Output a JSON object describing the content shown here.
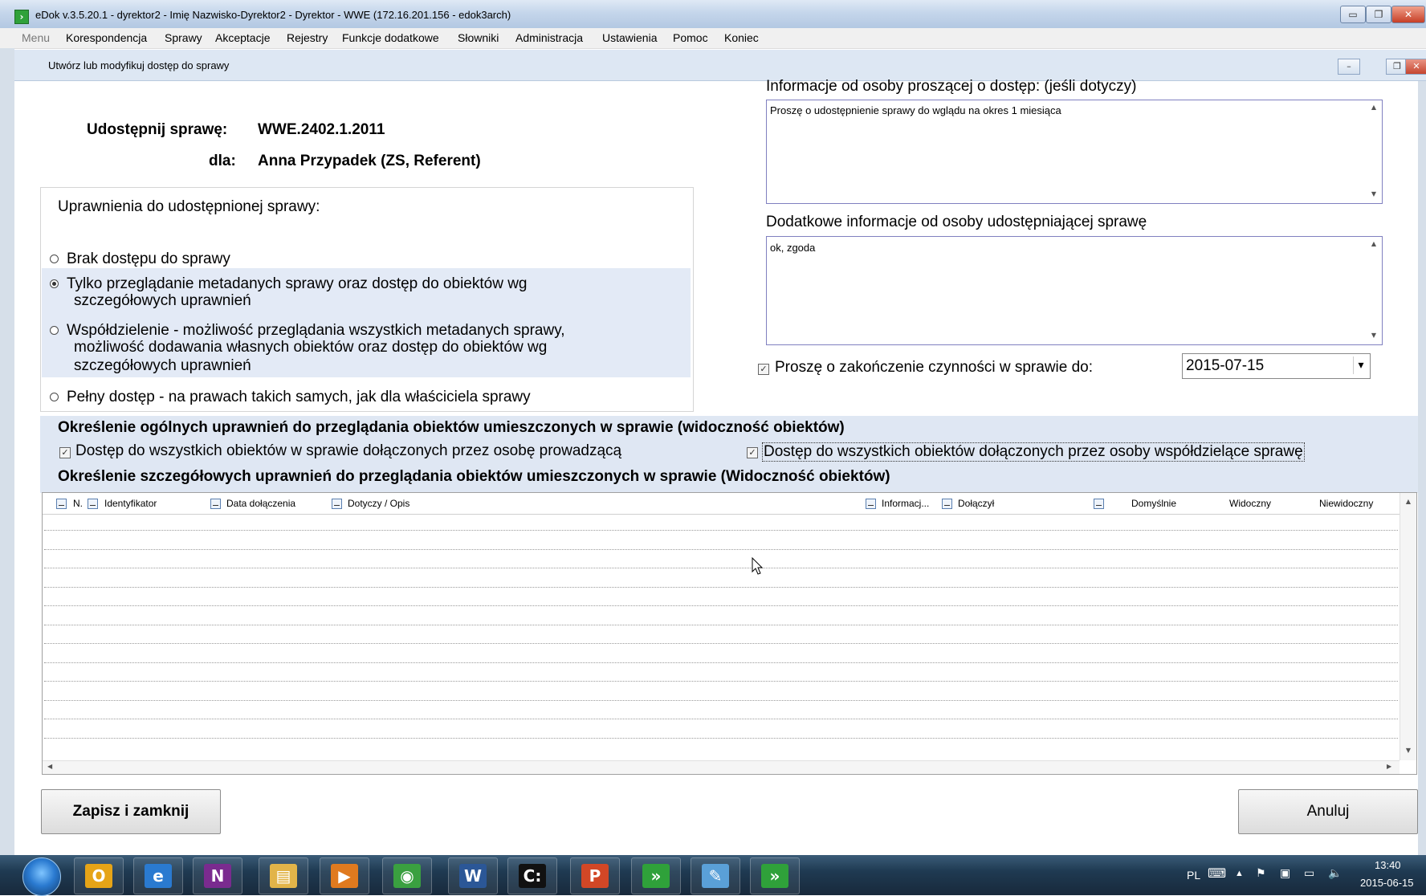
{
  "window": {
    "title": "eDok v.3.5.20.1 - dyrektor2 - Imię Nazwisko-Dyrektor2 - Dyrektor - WWE   (172.16.201.156 - edok3arch)",
    "app_icon": "edok-app-icon",
    "min_glyph": "▭",
    "max_glyph": "❐",
    "close_glyph": "✕"
  },
  "menu": {
    "label": "Menu",
    "items": [
      "Korespondencja",
      "Sprawy",
      "Akceptacje",
      "Rejestry",
      "Funkcje dodatkowe",
      "Słowniki",
      "Administracja",
      "Ustawienia",
      "Pomoc",
      "Koniec"
    ]
  },
  "child": {
    "title": "Utwórz lub modyfikuj dostęp do sprawy",
    "min_glyph": "–",
    "max_glyph": "❐",
    "close_glyph": "✕"
  },
  "form": {
    "share_label": "Udostępnij sprawę:",
    "share_value": "WWE.2402.1.2011",
    "for_label": "dla:",
    "for_value": "Anna Przypadek (ZS, Referent)",
    "permissions_title": "Uprawnienia do udostępnionej sprawy:",
    "options": [
      {
        "lines": [
          "Brak dostępu do sprawy"
        ],
        "selected": false
      },
      {
        "lines": [
          "Tylko przeglądanie metadanych sprawy oraz dostęp do obiektów wg",
          "szczegółowych uprawnień"
        ],
        "selected": true
      },
      {
        "lines": [
          "Współdzielenie - możliwość przeglądania wszystkich metadanych sprawy,",
          "możliwość dodawania własnych obiektów oraz dostęp do obiektów wg",
          "szczegółowych uprawnień"
        ],
        "selected": false
      },
      {
        "lines": [
          "Pełny dostęp - na prawach takich samych, jak dla właściciela sprawy"
        ],
        "selected": false
      }
    ],
    "requester_info_label": "Informacje od osoby proszącej o dostęp: (jeśli dotyczy)",
    "requester_info_value": "Proszę o udostępnienie sprawy do wglądu na okres 1 miesiąca",
    "sharer_info_label": "Dodatkowe informacje od osoby udostępniającej sprawę",
    "sharer_info_value": "ok, zgoda",
    "deadline_label": "Proszę o zakończenie czynności w sprawie do:",
    "deadline_checked": true,
    "deadline_value": "2015-07-15",
    "general_title": "Określenie ogólnych uprawnień do przeglądania obiektów umieszczonych w sprawie (widoczność obiektów)",
    "cb_owner_label": "Dostęp do wszystkich obiektów w sprawie dołączonych przez osobę prowadzącą",
    "cb_owner_checked": true,
    "cb_shared_label": "Dostęp do wszystkich obiektów dołączonych przez osoby współdzielące sprawę",
    "cb_shared_checked": true,
    "detailed_title": "Określenie szczegółowych uprawnień do przeglądania obiektów umieszczonych w sprawie (Widoczność obiektów)",
    "check_glyph": "✓",
    "dropdown_glyph": "▾"
  },
  "grid": {
    "columns": [
      "N.",
      "Identyfikator",
      "Data dołączenia",
      "Dotyczy / Opis",
      "Informacj...",
      "Dołączył",
      "Domyślnie",
      "Widoczny",
      "Niewidoczny"
    ],
    "rows": 12
  },
  "buttons": {
    "save": "Zapisz i zamknij",
    "cancel": "Anuluj"
  },
  "taskbar": {
    "apps": [
      {
        "name": "outlook",
        "glyph": "O",
        "color": "#e6a417"
      },
      {
        "name": "internet-explorer",
        "glyph": "e",
        "color": "#2a7ad0"
      },
      {
        "name": "onenote",
        "glyph": "N",
        "color": "#7a2b8f"
      },
      {
        "name": "file-explorer",
        "glyph": "▤",
        "color": "#e2b449"
      },
      {
        "name": "media-player",
        "glyph": "▶",
        "color": "#e07a1f"
      },
      {
        "name": "chrome",
        "glyph": "◉",
        "color": "#3aa040"
      },
      {
        "name": "word",
        "glyph": "W",
        "color": "#2b5797"
      },
      {
        "name": "command-prompt",
        "glyph": "C:",
        "color": "#111111"
      },
      {
        "name": "powerpoint",
        "glyph": "P",
        "color": "#d24726"
      },
      {
        "name": "edok",
        "glyph": "»",
        "color": "#2fa13a"
      },
      {
        "name": "notepad",
        "glyph": "✎",
        "color": "#5aa0d8"
      },
      {
        "name": "edok-active",
        "glyph": "»",
        "color": "#2fa13a"
      }
    ],
    "language": "PL",
    "time": "13:40",
    "date": "2015-06-15"
  }
}
